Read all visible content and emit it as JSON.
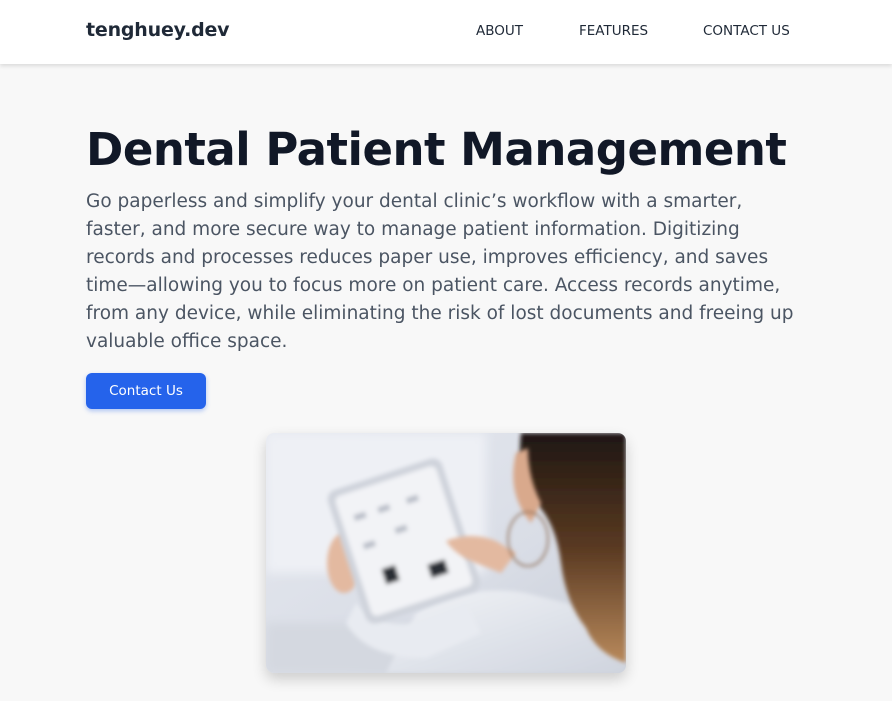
{
  "navbar": {
    "brand": "tenghuey.dev",
    "links": [
      {
        "label": "ABOUT"
      },
      {
        "label": "FEATURES"
      },
      {
        "label": "CONTACT US"
      }
    ]
  },
  "hero": {
    "title": "Dental Patient Management",
    "description": "Go paperless and simplify your dental clinic’s workflow with a smarter, faster, and more secure way to manage patient information. Digitizing records and processes reduces paper use, improves efficiency, and saves time—allowing you to focus more on patient care. Access records anytime, from any device, while eliminating the risk of lost documents and freeing up valuable office space.",
    "cta_label": "Contact Us",
    "image_icon": "photo-woman-holding-tablet"
  },
  "colors": {
    "accent": "#2563eb",
    "heading": "#111827",
    "body_text": "#4b5563",
    "background": "#f8f8f8"
  }
}
